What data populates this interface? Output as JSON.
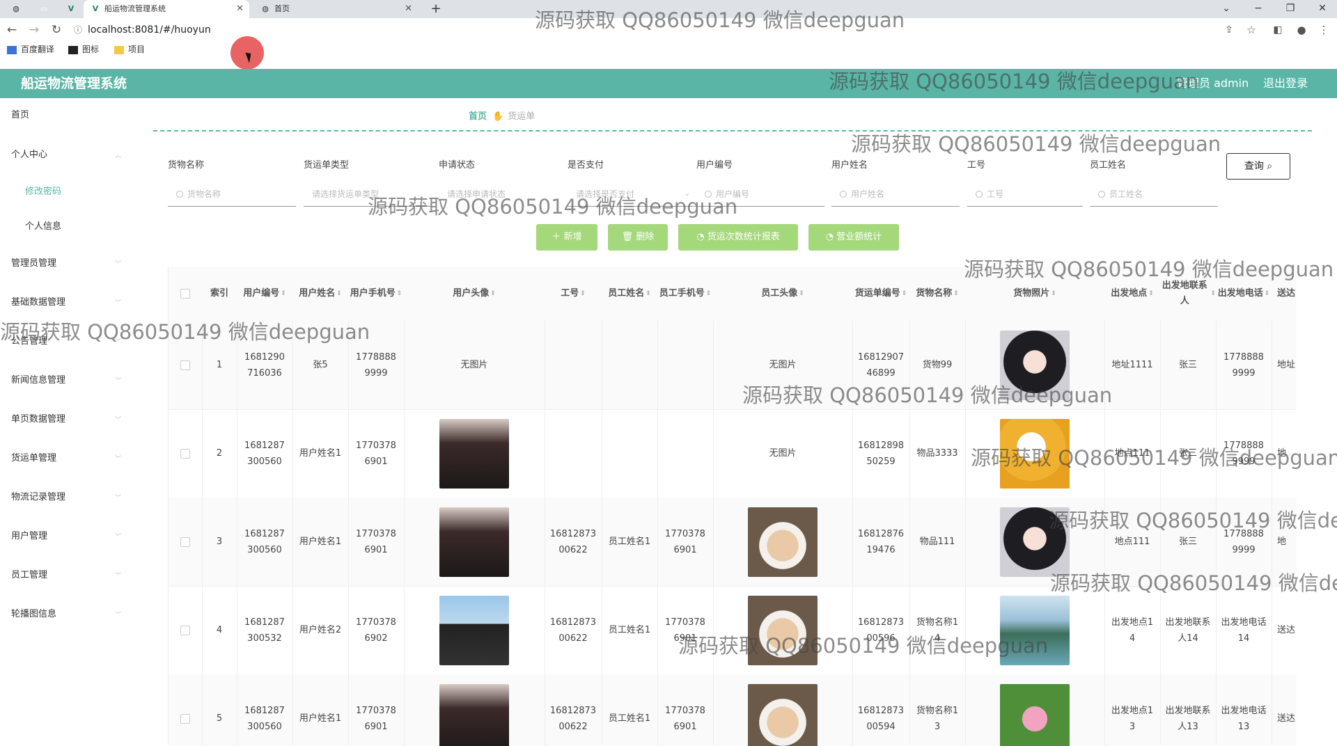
{
  "browser": {
    "tabs": [
      {
        "title": "船运物流管理系统",
        "active": true
      },
      {
        "title": "首页",
        "active": false
      }
    ],
    "url": "localhost:8081/#/huoyun",
    "bookmarks": [
      "百度翻译",
      "图标",
      "项目"
    ]
  },
  "header": {
    "title": "船运物流管理系统",
    "user": "管理员 admin",
    "logout": "退出登录"
  },
  "sidebar": {
    "items": [
      {
        "label": "首页"
      },
      {
        "label": "个人中心"
      },
      {
        "label": "修改密码"
      },
      {
        "label": "个人信息"
      },
      {
        "label": "管理员管理"
      },
      {
        "label": "基础数据管理"
      },
      {
        "label": "公告管理"
      },
      {
        "label": "新闻信息管理"
      },
      {
        "label": "单页数据管理"
      },
      {
        "label": "货运单管理"
      },
      {
        "label": "物流记录管理"
      },
      {
        "label": "用户管理"
      },
      {
        "label": "员工管理"
      },
      {
        "label": "轮播图信息"
      }
    ]
  },
  "breadcrumb": {
    "home": "首页",
    "current": "货运单"
  },
  "filters": [
    {
      "label": "货物名称",
      "placeholder": "货物名称"
    },
    {
      "label": "货运单类型",
      "placeholder": "请选择货运单类型"
    },
    {
      "label": "申请状态",
      "placeholder": "请选择申请状态"
    },
    {
      "label": "是否支付",
      "placeholder": "请选择是否支付"
    },
    {
      "label": "用户编号",
      "placeholder": "用户编号"
    },
    {
      "label": "用户姓名",
      "placeholder": "用户姓名"
    },
    {
      "label": "工号",
      "placeholder": "工号"
    },
    {
      "label": "员工姓名",
      "placeholder": "员工姓名"
    }
  ],
  "query_label": "查询",
  "actions": [
    "＋ 新增",
    "删除",
    "货运次数统计报表",
    "营业额统计"
  ],
  "table": {
    "headers": [
      "索引",
      "用户编号",
      "用户姓名",
      "用户手机号",
      "用户头像",
      "工号",
      "员工姓名",
      "员工手机号",
      "员工头像",
      "货运单编号",
      "货物名称",
      "货物照片",
      "出发地点",
      "出发地联系人",
      "出发地电话",
      "送达"
    ],
    "rows": [
      {
        "index": "1",
        "user_no": "1681290716036",
        "user_name": "张5",
        "user_phone": "17788889999",
        "user_avatar": "无图片",
        "emp_no": "",
        "emp_name": "",
        "emp_phone": "",
        "emp_avatar": "无图片",
        "order_no": "1681290746899",
        "goods_name": "货物99",
        "goods_photo": "girl",
        "from_place": "地址1111",
        "from_contact": "张三",
        "from_phone": "17788889999",
        "to": "地址"
      },
      {
        "index": "2",
        "user_no": "1681287300560",
        "user_name": "用户姓名1",
        "user_phone": "17703786901",
        "user_avatar": "man-a",
        "emp_no": "",
        "emp_name": "",
        "emp_phone": "",
        "emp_avatar": "无图片",
        "order_no": "1681289850259",
        "goods_name": "物品3333",
        "goods_photo": "cartoon",
        "from_place": "地点111",
        "from_contact": "张三",
        "from_phone": "17788889999",
        "to": "地"
      },
      {
        "index": "3",
        "user_no": "1681287300560",
        "user_name": "用户姓名1",
        "user_phone": "17703786901",
        "user_avatar": "man-a",
        "emp_no": "1681287300622",
        "emp_name": "员工姓名1",
        "emp_phone": "17703786901",
        "emp_avatar": "cat",
        "order_no": "1681287619476",
        "goods_name": "物品111",
        "goods_photo": "girl",
        "from_place": "地点111",
        "from_contact": "张三",
        "from_phone": "17788889999",
        "to": "地"
      },
      {
        "index": "4",
        "user_no": "1681287300532",
        "user_name": "用户姓名2",
        "user_phone": "17703786902",
        "user_avatar": "man-c",
        "emp_no": "1681287300622",
        "emp_name": "员工姓名1",
        "emp_phone": "17703786901",
        "emp_avatar": "cat",
        "order_no": "1681287300596",
        "goods_name": "货物名称14",
        "goods_photo": "mountain",
        "from_place": "出发地点14",
        "from_contact": "出发地联系人14",
        "from_phone": "出发地电话14",
        "to": "送达"
      },
      {
        "index": "5",
        "user_no": "1681287300560",
        "user_name": "用户姓名1",
        "user_phone": "17703786901",
        "user_avatar": "man-a",
        "emp_no": "1681287300622",
        "emp_name": "员工姓名1",
        "emp_phone": "17703786901",
        "emp_avatar": "cat",
        "order_no": "1681287300594",
        "goods_name": "货物名称13",
        "goods_photo": "lotus",
        "from_place": "出发地点13",
        "from_contact": "出发地联系人13",
        "from_phone": "出发地电话13",
        "to": "送达"
      }
    ]
  },
  "watermark": "源码获取 QQ86050149 微信deepguan",
  "colors": {
    "accent": "#5ab5a6",
    "button": "#a4d87a"
  }
}
